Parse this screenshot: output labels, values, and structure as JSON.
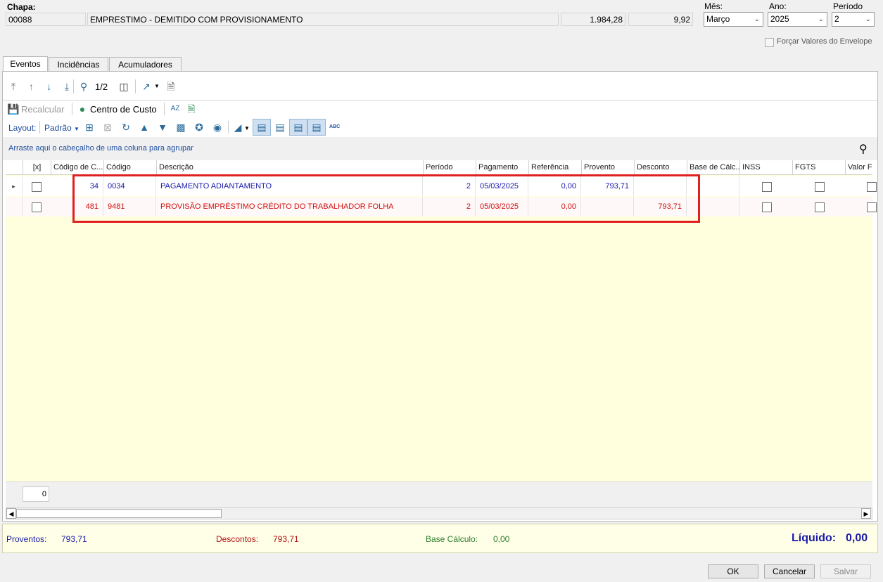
{
  "header": {
    "chapa_label": "Chapa:",
    "chapa_code": "00088",
    "employee_name": "EMPRESTIMO - DEMITIDO COM PROVISIONAMENTO",
    "value1": "1.984,28",
    "value2": "9,92",
    "mes_label": "Mês:",
    "mes_value": "Março",
    "ano_label": "Ano:",
    "ano_value": "2025",
    "periodo_label": "Período",
    "periodo_value": "2",
    "forcar_label": "Forçar Valores do Envelope"
  },
  "tabs": [
    {
      "label": "Eventos",
      "active": true
    },
    {
      "label": "Incidências",
      "active": false
    },
    {
      "label": "Acumuladores",
      "active": false
    }
  ],
  "toolbar": {
    "page_indicator": "1/2",
    "recalcular": "Recalcular",
    "centro_custo": "Centro de Custo",
    "layout_label": "Layout:",
    "layout_value": "Padrão",
    "abc": "ABC"
  },
  "group_hint": "Arraste aqui o cabeçalho de uma coluna para agrupar",
  "columns": [
    "[x]",
    "Código de C...",
    "Código",
    "Descrição",
    "Período",
    "Pagamento",
    "Referência",
    "Provento",
    "Desconto",
    "Base de Cálc...",
    "INSS",
    "FGTS",
    "Valor Fo"
  ],
  "rows": [
    {
      "codigo_c": "34",
      "codigo": "0034",
      "descricao": "PAGAMENTO ADIANTAMENTO",
      "periodo": "2",
      "pagamento": "05/03/2025",
      "referencia": "0,00",
      "provento": "793,71",
      "desconto": "",
      "color": "#1a1aa8"
    },
    {
      "codigo_c": "481",
      "codigo": "9481",
      "descricao": "PROVISÃO EMPRÉSTIMO CRÉDITO DO TRABALHADOR FOLHA",
      "periodo": "2",
      "pagamento": "05/03/2025",
      "referencia": "0,00",
      "provento": "",
      "desconto": "793,71",
      "color": "#d01010"
    }
  ],
  "footer_count": "0",
  "summary": {
    "proventos_label": "Proventos:",
    "proventos_value": "793,71",
    "descontos_label": "Descontos:",
    "descontos_value": "793,71",
    "base_label": "Base Cálculo:",
    "base_value": "0,00",
    "liquido_label": "Líquido:",
    "liquido_value": "0,00"
  },
  "buttons": {
    "ok": "OK",
    "cancelar": "Cancelar",
    "salvar": "Salvar"
  },
  "colors": {
    "highlight": "#e02020",
    "grid_bg": "#ffffdd",
    "summary_bg": "#ffffe8"
  }
}
